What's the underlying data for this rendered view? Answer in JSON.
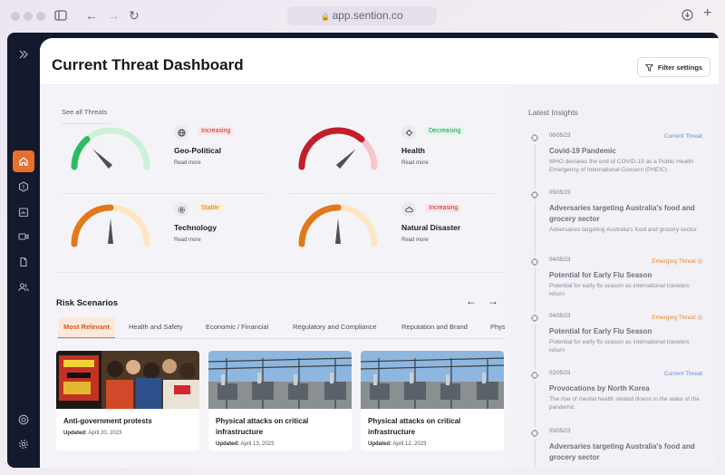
{
  "browser": {
    "url": "app.sention.co"
  },
  "header": {
    "title": "Current Threat Dashboard",
    "filter_label": "Filter settings"
  },
  "threats": {
    "see_all": "See all Threats",
    "items": [
      {
        "name": "Geo-Political",
        "status": "Increasing",
        "status_color": "#c22a2a",
        "status_bg": "#fde6e6",
        "read_more": "Read more",
        "level": 0.25,
        "icon": "globe-icon"
      },
      {
        "name": "Health",
        "status": "Decreasing",
        "status_color": "#1c9a52",
        "status_bg": "#e1f6ea",
        "read_more": "Read more",
        "level": 0.75,
        "icon": "virus-icon"
      },
      {
        "name": "Technology",
        "status": "Stable",
        "status_color": "#d47a13",
        "status_bg": "#fdf0dc",
        "read_more": "Read more",
        "level": 0.5,
        "icon": "gear-icon"
      },
      {
        "name": "Natural Disaster",
        "status": "Increasing",
        "status_color": "#c22a2a",
        "status_bg": "#fde6e6",
        "read_more": "Read more",
        "level": 0.5,
        "icon": "cloud-icon"
      }
    ]
  },
  "risk_scenarios": {
    "title": "Risk Scenarios",
    "tabs": [
      "Most Relevant",
      "Health and Safety",
      "Economic / Financial",
      "Regulatory and Compliance",
      "Reputation and Brand",
      "Phys"
    ],
    "cards": [
      {
        "title": "Anti-government protests",
        "updated_label": "Updated:",
        "date": "April 20, 2023"
      },
      {
        "title": "Physical attacks on critical infrastructure",
        "updated_label": "Updated:",
        "date": "April 13, 2023"
      },
      {
        "title": "Physical attacks on critical infrastructure",
        "updated_label": "Updated:",
        "date": "April 12, 2023"
      }
    ]
  },
  "insights": {
    "title": "Latest Insights",
    "items": [
      {
        "date": "06/05/23",
        "tag": "Current Threat",
        "tag_color": "#6d8fd9",
        "title": "Covid-19 Pandemic",
        "desc": "WHO declares the end of COVID-19 as a Public Health Emergency of International Concern (PHEIC)"
      },
      {
        "date": "05/05/23",
        "tag": "",
        "tag_color": "#6d8fd9",
        "title": "Adversaries targeting Australia's food and grocery sector",
        "desc": "Adversaries targeting Australia's food and grocery sector"
      },
      {
        "date": "04/05/23",
        "tag": "Emerging Threat",
        "tag_color": "#e08a3a",
        "title": "Potential for Early Flu Season",
        "desc": "Potential for early flu season as international travelers return"
      },
      {
        "date": "04/05/23",
        "tag": "Emerging Threat",
        "tag_color": "#e08a3a",
        "title": "Potential for Early Flu Season",
        "desc": "Potential for early flu season as international travelers return"
      },
      {
        "date": "02/05/23",
        "tag": "Current Threat",
        "tag_color": "#6d8fd9",
        "title": "Provocations by North Korea",
        "desc": "The rise of mental health related illness in the wake of the pandemic"
      },
      {
        "date": "05/05/23",
        "tag": "",
        "tag_color": "#6d8fd9",
        "title": "Adversaries targeting Australia's food and grocery sector",
        "desc": ""
      }
    ]
  },
  "colors": {
    "accent": "#e8702a",
    "sidebar": "#141a2e"
  }
}
